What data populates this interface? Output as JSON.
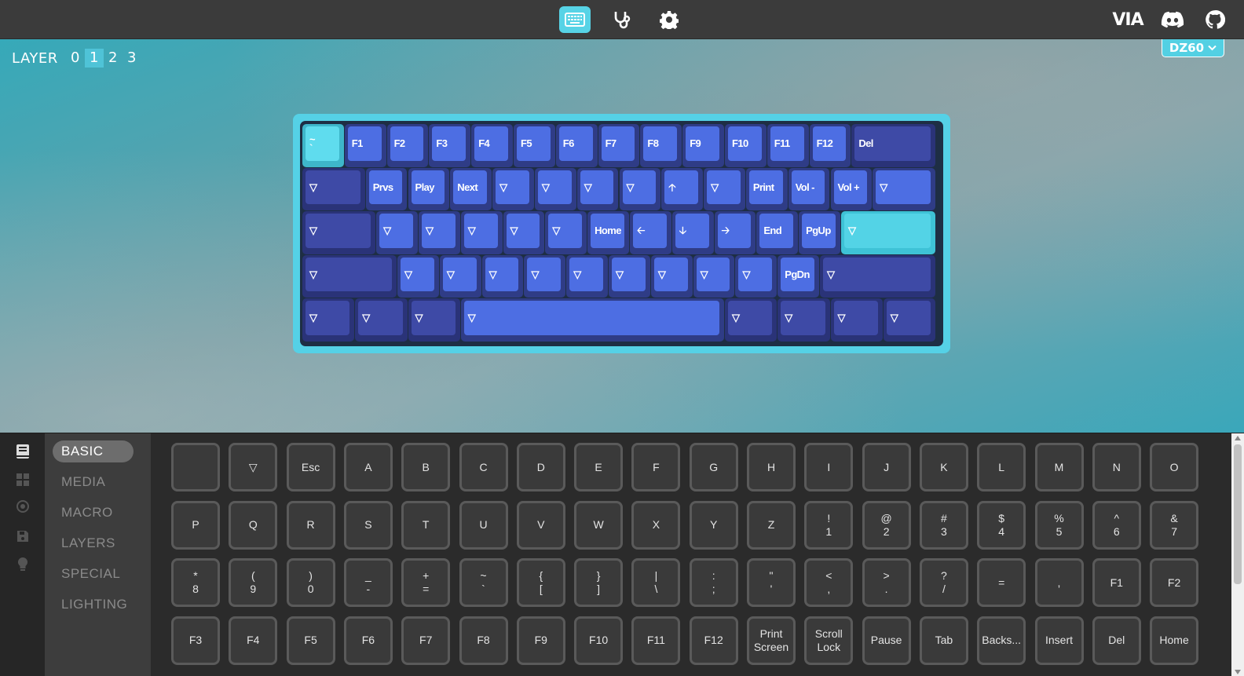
{
  "nav": {
    "icons": [
      "keyboard-icon",
      "stethoscope-icon",
      "gear-icon"
    ],
    "active": "keyboard-icon",
    "logo": "VIA",
    "right_icons": [
      "discord-icon",
      "github-icon"
    ]
  },
  "layers": {
    "label": "LAYER",
    "options": [
      "0",
      "1",
      "2",
      "3"
    ],
    "active": "1"
  },
  "device": {
    "name": "DZ60",
    "icon": "chevron-down-icon"
  },
  "keyboard": {
    "rows": [
      [
        "~\n`",
        "F1",
        "F2",
        "F3",
        "F4",
        "F5",
        "F6",
        "F7",
        "F8",
        "F9",
        "F10",
        "F11",
        "F12",
        "Del"
      ],
      [
        "▽",
        "Prvs",
        "Play",
        "Next",
        "▽",
        "▽",
        "▽",
        "▽",
        "🡡",
        "▽",
        "Print",
        "Vol -",
        "Vol +",
        "▽"
      ],
      [
        "▽",
        "▽",
        "▽",
        "▽",
        "▽",
        "▽",
        "Home",
        "🡠",
        "🡣",
        "🡢",
        "End",
        "PgUp",
        "▽"
      ],
      [
        "▽",
        "▽",
        "▽",
        "▽",
        "▽",
        "▽",
        "▽",
        "▽",
        "▽",
        "▽",
        "PgDn",
        "▽"
      ],
      [
        "▽",
        "▽",
        "▽",
        "▽",
        "▽",
        "▽",
        "▽",
        "▽"
      ]
    ]
  },
  "sidebar": {
    "icons": [
      "book-icon",
      "grid-icon",
      "target-icon",
      "save-icon",
      "lightbulb-icon"
    ],
    "menu": [
      "BASIC",
      "MEDIA",
      "MACRO",
      "LAYERS",
      "SPECIAL",
      "LIGHTING"
    ],
    "active": "BASIC"
  },
  "keycodes": [
    [
      "",
      "▽",
      "Esc",
      "A",
      "B",
      "C",
      "D",
      "E",
      "F",
      "G",
      "H",
      "I",
      "J",
      "K",
      "L",
      "M",
      "N",
      "O"
    ],
    [
      "P",
      "Q",
      "R",
      "S",
      "T",
      "U",
      "V",
      "W",
      "X",
      "Y",
      "Z",
      "!\n1",
      "@\n2",
      "#\n3",
      "$\n4",
      "%\n5",
      "^\n6",
      "&\n7"
    ],
    [
      "*\n8",
      "(\n9",
      ")\n0",
      "_\n-",
      "+\n=",
      "~\n`",
      "{\n[",
      "}\n]",
      "|\n\\",
      ":\n;",
      "\"\n'",
      "<\n,",
      ">\n.",
      "?\n/",
      "=",
      ",",
      "F1",
      "F2"
    ],
    [
      "F3",
      "F4",
      "F5",
      "F6",
      "F7",
      "F8",
      "F9",
      "F10",
      "F11",
      "F12",
      "Print\nScreen",
      "Scroll\nLock",
      "Pause",
      "Tab",
      "Backs...",
      "Insert",
      "Del",
      "Home"
    ]
  ]
}
